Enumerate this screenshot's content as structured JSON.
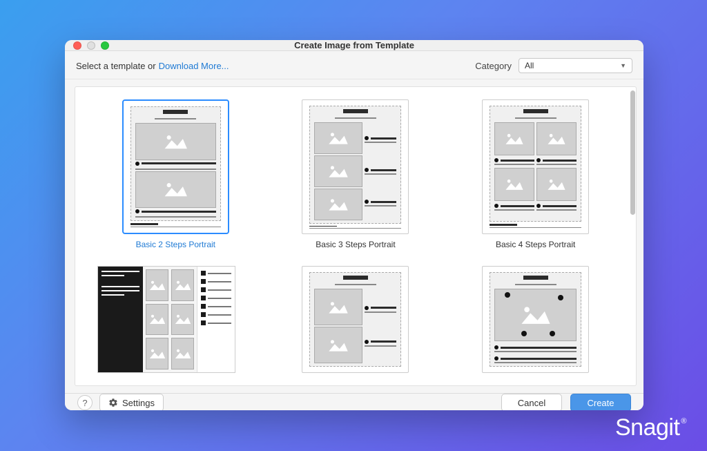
{
  "brand": "Snagit",
  "window": {
    "title": "Create Image from Template"
  },
  "header": {
    "select_label": "Select a template or",
    "download_link": "Download More...",
    "category_label": "Category",
    "category_value": "All"
  },
  "templates": [
    {
      "label": "Basic 2 Steps Portrait",
      "selected": true
    },
    {
      "label": "Basic 3 Steps Portrait",
      "selected": false
    },
    {
      "label": "Basic 4 Steps Portrait",
      "selected": false
    },
    {
      "label": "",
      "selected": false
    },
    {
      "label": "",
      "selected": false
    },
    {
      "label": "",
      "selected": false
    }
  ],
  "footer": {
    "help_glyph": "?",
    "settings_label": "Settings",
    "cancel_label": "Cancel",
    "create_label": "Create"
  }
}
